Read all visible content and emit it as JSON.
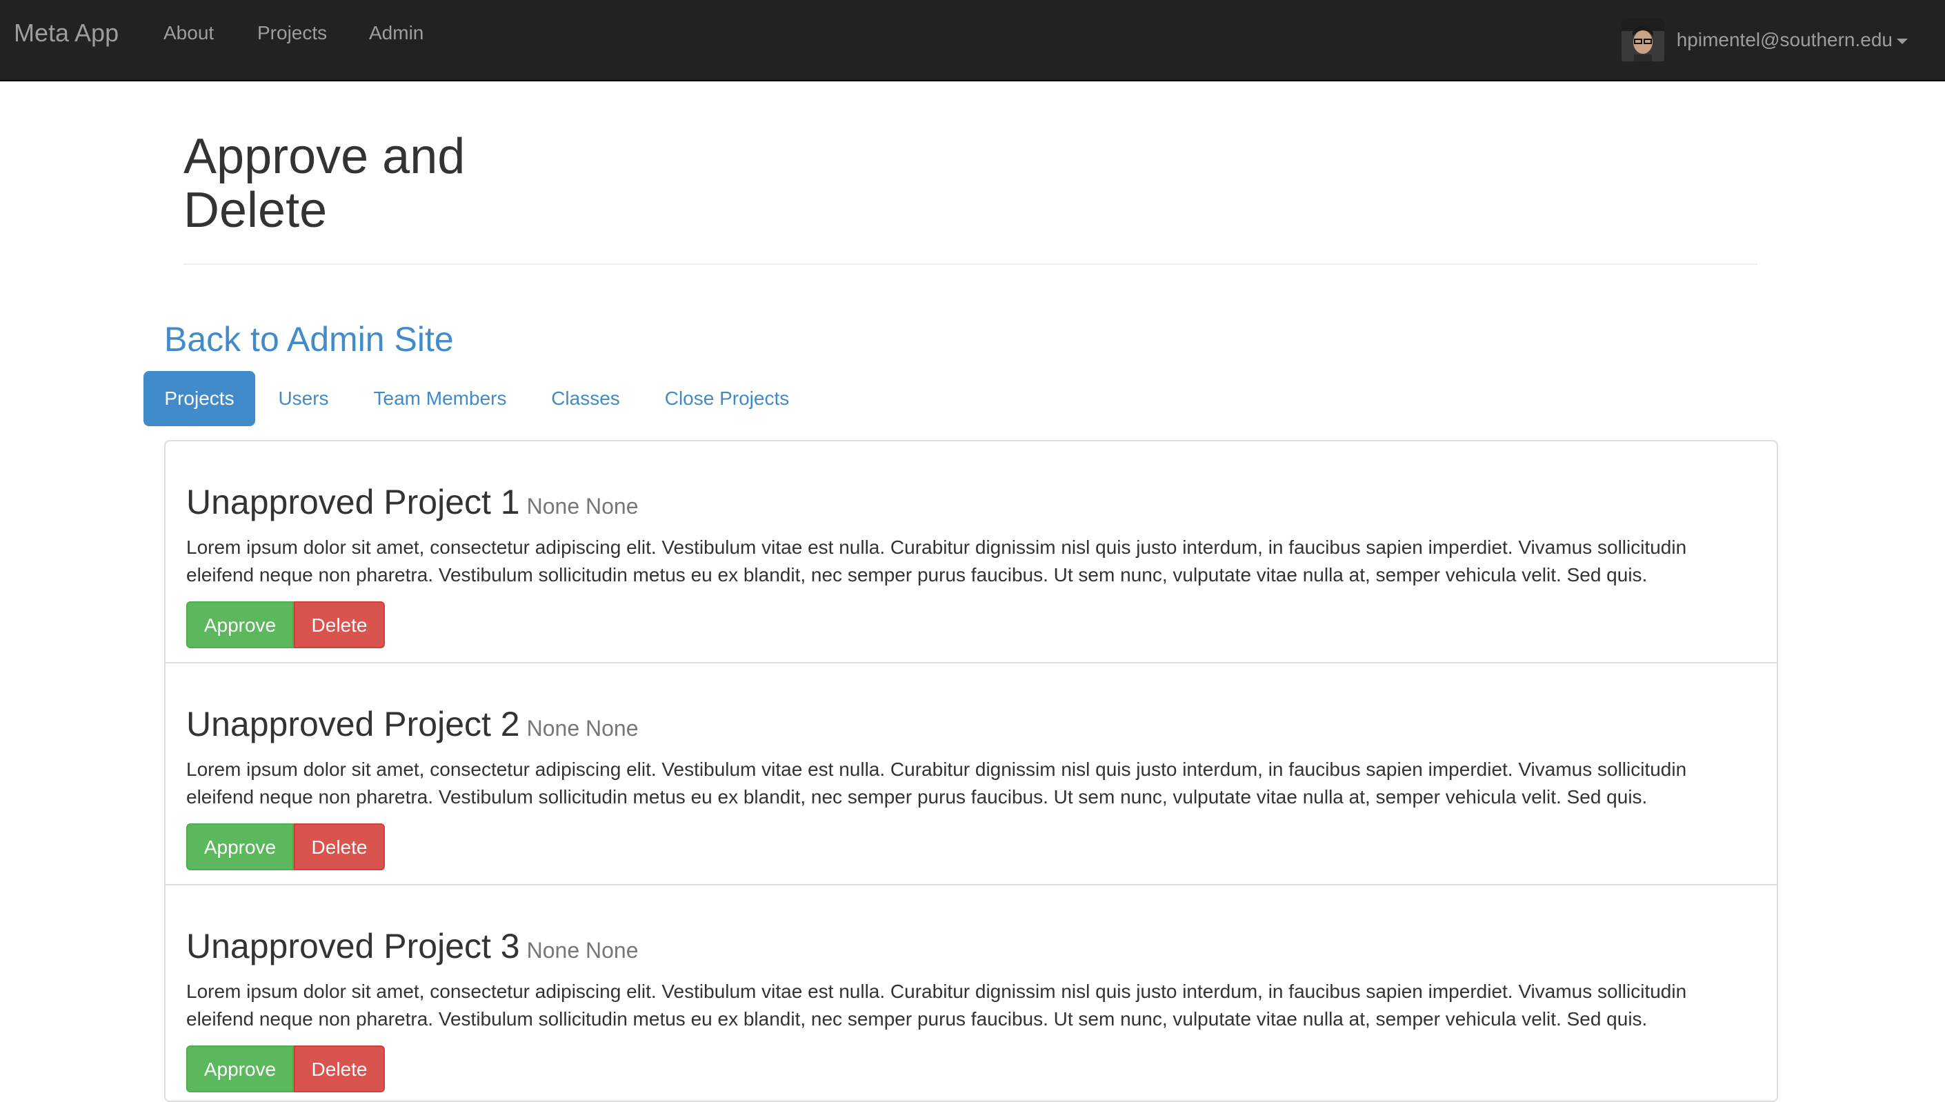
{
  "navbar": {
    "brand": "Meta App",
    "links": [
      "About",
      "Projects",
      "Admin"
    ],
    "user_email": "hpimentel@southern.edu"
  },
  "page": {
    "title": "Approve and Delete",
    "back_link": "Back to Admin Site"
  },
  "tabs": [
    {
      "label": "Projects",
      "active": true
    },
    {
      "label": "Users",
      "active": false
    },
    {
      "label": "Team Members",
      "active": false
    },
    {
      "label": "Classes",
      "active": false
    },
    {
      "label": "Close Projects",
      "active": false
    }
  ],
  "projects": [
    {
      "title": "Unapproved Project 1",
      "meta": "None None",
      "description": "Lorem ipsum dolor sit amet, consectetur adipiscing elit. Vestibulum vitae est nulla. Curabitur dignissim nisl quis justo interdum, in faucibus sapien imperdiet. Vivamus sollicitudin eleifend neque non pharetra. Vestibulum sollicitudin metus eu ex blandit, nec semper purus faucibus. Ut sem nunc, vulputate vitae nulla at, semper vehicula velit. Sed quis.",
      "approve_label": "Approve",
      "delete_label": "Delete"
    },
    {
      "title": "Unapproved Project 2",
      "meta": "None None",
      "description": "Lorem ipsum dolor sit amet, consectetur adipiscing elit. Vestibulum vitae est nulla. Curabitur dignissim nisl quis justo interdum, in faucibus sapien imperdiet. Vivamus sollicitudin eleifend neque non pharetra. Vestibulum sollicitudin metus eu ex blandit, nec semper purus faucibus. Ut sem nunc, vulputate vitae nulla at, semper vehicula velit. Sed quis.",
      "approve_label": "Approve",
      "delete_label": "Delete"
    },
    {
      "title": "Unapproved Project 3",
      "meta": "None None",
      "description": "Lorem ipsum dolor sit amet, consectetur adipiscing elit. Vestibulum vitae est nulla. Curabitur dignissim nisl quis justo interdum, in faucibus sapien imperdiet. Vivamus sollicitudin eleifend neque non pharetra. Vestibulum sollicitudin metus eu ex blandit, nec semper purus faucibus. Ut sem nunc, vulputate vitae nulla at, semper vehicula velit. Sed quis.",
      "approve_label": "Approve",
      "delete_label": "Delete"
    }
  ],
  "colors": {
    "navbar_bg": "#222222",
    "link": "#428bca",
    "approve": "#5cb85c",
    "delete": "#d9534f"
  },
  "icons": [
    "avatar-image",
    "caret-down-icon"
  ]
}
